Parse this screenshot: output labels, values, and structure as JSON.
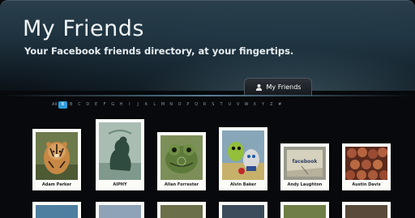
{
  "header": {
    "title": "My Friends",
    "subtitle": "Your Facebook friends directory, at your fingertips."
  },
  "tab": {
    "label": "My Friends",
    "icon": "person-icon"
  },
  "alphabet": {
    "letters": [
      "All",
      "B",
      "B",
      "C",
      "D",
      "E",
      "F",
      "G",
      "H",
      "I",
      "J",
      "K",
      "L",
      "M",
      "N",
      "O",
      "P",
      "Q",
      "R",
      "S",
      "T",
      "U",
      "V",
      "W",
      "X",
      "Y",
      "Z",
      "#"
    ],
    "selected_index": 1
  },
  "friends": [
    {
      "name": "Adam Parker"
    },
    {
      "name": "AIPHY"
    },
    {
      "name": "Allan Forrester"
    },
    {
      "name": "Alvin Baker"
    },
    {
      "name": "Andy Laughton"
    },
    {
      "name": "Austin Davis"
    }
  ],
  "photo_labels": {
    "andy": "facebook"
  },
  "colors": {
    "background": "#07090c",
    "header": "#1f3340",
    "selected_letter": "#2f9bd8",
    "card": "#fbfbf8"
  }
}
